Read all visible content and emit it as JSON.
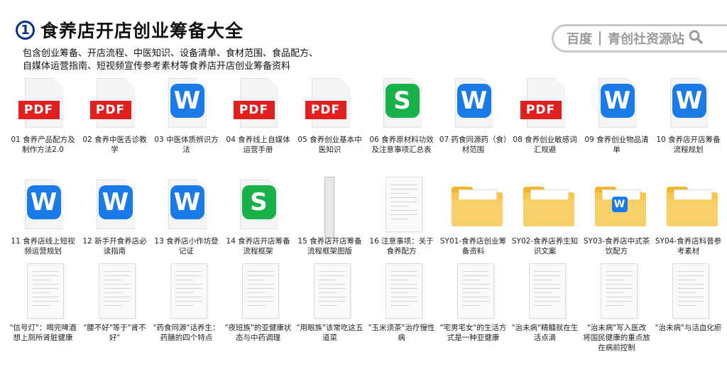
{
  "header": {
    "badge": "1",
    "title": "食养店开店创业筹备大全",
    "desc_line1": "包含创业筹备、开店流程、中医知识、设备清单、食材范围、食品配方、",
    "desc_line2": "自媒体运营指南、短视频宣传参考素材等食养店开店创业筹备资料"
  },
  "search": {
    "left": "百度",
    "right": "青创社资源站",
    "icon": "search-icon"
  },
  "colors": {
    "pdf": "#e02020",
    "word": "#1a7ae8",
    "sheet": "#18b14a",
    "folder": "#f9c64a",
    "badge": "#0a2f8a"
  },
  "rows": [
    [
      {
        "type": "pdf",
        "label": "01 食养产品配方及制作方法2.0",
        "badge": "PDF"
      },
      {
        "type": "pdf",
        "label": "02 食养中医舌诊教学",
        "badge": "PDF"
      },
      {
        "type": "word",
        "label": "03 中医体质辨识方法",
        "badge": "W"
      },
      {
        "type": "pdf",
        "label": "04 食养线上自媒体运营手册",
        "badge": "PDF"
      },
      {
        "type": "pdf",
        "label": "05 食养创业基本中医知识",
        "badge": "PDF"
      },
      {
        "type": "sheet",
        "label": "06 食养原材料功效及注意事项汇总表",
        "badge": "S"
      },
      {
        "type": "word",
        "label": "07 药食同源药（食）材范围",
        "badge": "W"
      },
      {
        "type": "pdf",
        "label": "08 食养创业敏感词汇规避",
        "badge": "PDF"
      },
      {
        "type": "word",
        "label": "09 食养创业物品清单",
        "badge": "W"
      },
      {
        "type": "word",
        "label": "10 食养店开店筹备流程规划",
        "badge": "W"
      }
    ],
    [
      {
        "type": "word",
        "label": "11 食养店线上短视频运营规划",
        "badge": "W"
      },
      {
        "type": "word",
        "label": "12 新手开食养店必读指南",
        "badge": "W"
      },
      {
        "type": "word",
        "label": "13 食养店小作坊登记证",
        "badge": "W"
      },
      {
        "type": "sheet",
        "label": "14 食养店开店筹备流程框架",
        "badge": "S"
      },
      {
        "type": "tall",
        "label": "15 食养店开店筹备流程框架图版"
      },
      {
        "type": "blank",
        "label": "16 注意事项：关于食养配方"
      },
      {
        "type": "folder",
        "label": "SY01-食养店创业筹备资料"
      },
      {
        "type": "folder",
        "label": "SY02-食养店养生知识文案"
      },
      {
        "type": "folderw",
        "label": "SY03-食养店中式茶饮配方",
        "badge": "W"
      },
      {
        "type": "folder",
        "label": "SY04-食养店科普参考素材"
      }
    ],
    [
      {
        "type": "blank",
        "label": "\"信号灯\"：喝完啤酒想上厕所肾脏健康"
      },
      {
        "type": "blank",
        "label": "\"腰不好\"等于\"肾不好\""
      },
      {
        "type": "blank",
        "label": "\"药食同源\"话养生：药膳的四个特点"
      },
      {
        "type": "blank",
        "label": "\"夜班族\"的亚健康状态与中药调理"
      },
      {
        "type": "blank",
        "label": "\"用眼族\"该常吃这五道菜"
      },
      {
        "type": "blank",
        "label": "\"玉米须茶\"治疗慢性病"
      },
      {
        "type": "blank",
        "label": "\"宅男宅女\"的生活方式是一种亚健康"
      },
      {
        "type": "blank",
        "label": "\"治未病\"精髓就在生活点滴"
      },
      {
        "type": "blank",
        "label": "\"治未病\"写入医改 将国民健康的重点放在病前控制"
      },
      {
        "type": "blank",
        "label": "\"治未病\"与活血化瘀"
      }
    ]
  ]
}
